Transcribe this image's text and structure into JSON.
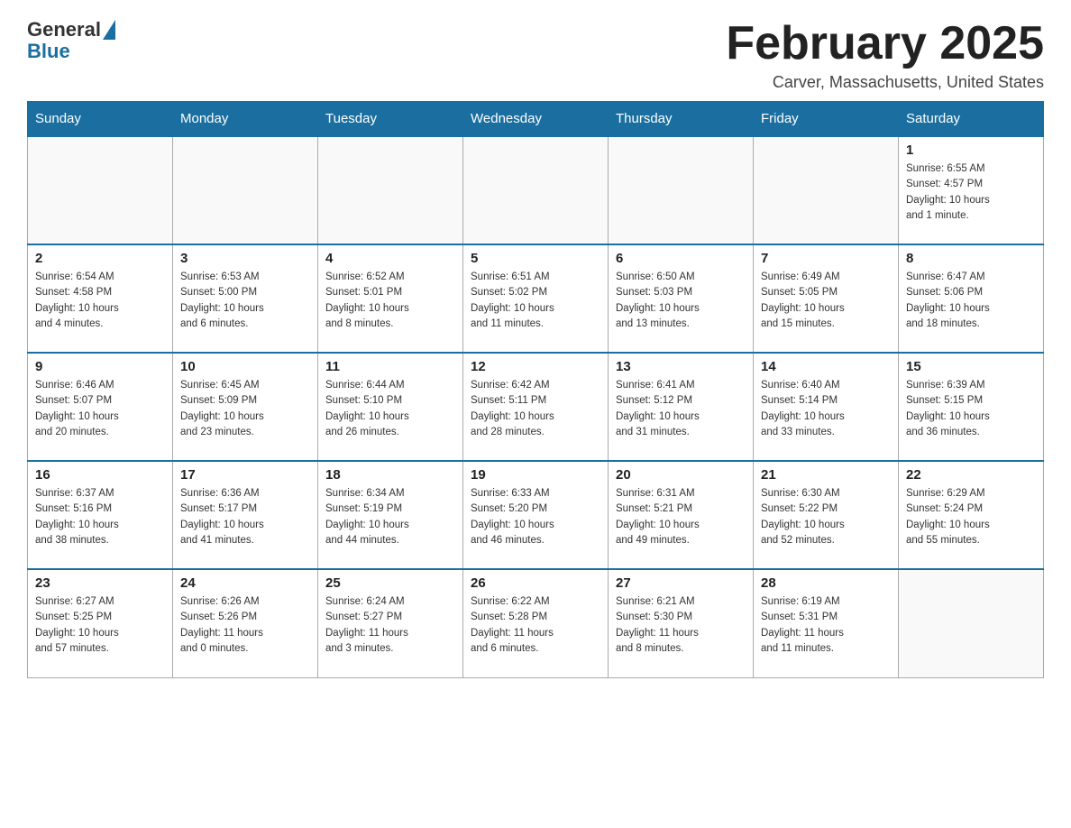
{
  "header": {
    "logo_general": "General",
    "logo_blue": "Blue",
    "month_title": "February 2025",
    "location": "Carver, Massachusetts, United States"
  },
  "days_of_week": [
    "Sunday",
    "Monday",
    "Tuesday",
    "Wednesday",
    "Thursday",
    "Friday",
    "Saturday"
  ],
  "weeks": [
    [
      {
        "day": "",
        "info": ""
      },
      {
        "day": "",
        "info": ""
      },
      {
        "day": "",
        "info": ""
      },
      {
        "day": "",
        "info": ""
      },
      {
        "day": "",
        "info": ""
      },
      {
        "day": "",
        "info": ""
      },
      {
        "day": "1",
        "info": "Sunrise: 6:55 AM\nSunset: 4:57 PM\nDaylight: 10 hours\nand 1 minute."
      }
    ],
    [
      {
        "day": "2",
        "info": "Sunrise: 6:54 AM\nSunset: 4:58 PM\nDaylight: 10 hours\nand 4 minutes."
      },
      {
        "day": "3",
        "info": "Sunrise: 6:53 AM\nSunset: 5:00 PM\nDaylight: 10 hours\nand 6 minutes."
      },
      {
        "day": "4",
        "info": "Sunrise: 6:52 AM\nSunset: 5:01 PM\nDaylight: 10 hours\nand 8 minutes."
      },
      {
        "day": "5",
        "info": "Sunrise: 6:51 AM\nSunset: 5:02 PM\nDaylight: 10 hours\nand 11 minutes."
      },
      {
        "day": "6",
        "info": "Sunrise: 6:50 AM\nSunset: 5:03 PM\nDaylight: 10 hours\nand 13 minutes."
      },
      {
        "day": "7",
        "info": "Sunrise: 6:49 AM\nSunset: 5:05 PM\nDaylight: 10 hours\nand 15 minutes."
      },
      {
        "day": "8",
        "info": "Sunrise: 6:47 AM\nSunset: 5:06 PM\nDaylight: 10 hours\nand 18 minutes."
      }
    ],
    [
      {
        "day": "9",
        "info": "Sunrise: 6:46 AM\nSunset: 5:07 PM\nDaylight: 10 hours\nand 20 minutes."
      },
      {
        "day": "10",
        "info": "Sunrise: 6:45 AM\nSunset: 5:09 PM\nDaylight: 10 hours\nand 23 minutes."
      },
      {
        "day": "11",
        "info": "Sunrise: 6:44 AM\nSunset: 5:10 PM\nDaylight: 10 hours\nand 26 minutes."
      },
      {
        "day": "12",
        "info": "Sunrise: 6:42 AM\nSunset: 5:11 PM\nDaylight: 10 hours\nand 28 minutes."
      },
      {
        "day": "13",
        "info": "Sunrise: 6:41 AM\nSunset: 5:12 PM\nDaylight: 10 hours\nand 31 minutes."
      },
      {
        "day": "14",
        "info": "Sunrise: 6:40 AM\nSunset: 5:14 PM\nDaylight: 10 hours\nand 33 minutes."
      },
      {
        "day": "15",
        "info": "Sunrise: 6:39 AM\nSunset: 5:15 PM\nDaylight: 10 hours\nand 36 minutes."
      }
    ],
    [
      {
        "day": "16",
        "info": "Sunrise: 6:37 AM\nSunset: 5:16 PM\nDaylight: 10 hours\nand 38 minutes."
      },
      {
        "day": "17",
        "info": "Sunrise: 6:36 AM\nSunset: 5:17 PM\nDaylight: 10 hours\nand 41 minutes."
      },
      {
        "day": "18",
        "info": "Sunrise: 6:34 AM\nSunset: 5:19 PM\nDaylight: 10 hours\nand 44 minutes."
      },
      {
        "day": "19",
        "info": "Sunrise: 6:33 AM\nSunset: 5:20 PM\nDaylight: 10 hours\nand 46 minutes."
      },
      {
        "day": "20",
        "info": "Sunrise: 6:31 AM\nSunset: 5:21 PM\nDaylight: 10 hours\nand 49 minutes."
      },
      {
        "day": "21",
        "info": "Sunrise: 6:30 AM\nSunset: 5:22 PM\nDaylight: 10 hours\nand 52 minutes."
      },
      {
        "day": "22",
        "info": "Sunrise: 6:29 AM\nSunset: 5:24 PM\nDaylight: 10 hours\nand 55 minutes."
      }
    ],
    [
      {
        "day": "23",
        "info": "Sunrise: 6:27 AM\nSunset: 5:25 PM\nDaylight: 10 hours\nand 57 minutes."
      },
      {
        "day": "24",
        "info": "Sunrise: 6:26 AM\nSunset: 5:26 PM\nDaylight: 11 hours\nand 0 minutes."
      },
      {
        "day": "25",
        "info": "Sunrise: 6:24 AM\nSunset: 5:27 PM\nDaylight: 11 hours\nand 3 minutes."
      },
      {
        "day": "26",
        "info": "Sunrise: 6:22 AM\nSunset: 5:28 PM\nDaylight: 11 hours\nand 6 minutes."
      },
      {
        "day": "27",
        "info": "Sunrise: 6:21 AM\nSunset: 5:30 PM\nDaylight: 11 hours\nand 8 minutes."
      },
      {
        "day": "28",
        "info": "Sunrise: 6:19 AM\nSunset: 5:31 PM\nDaylight: 11 hours\nand 11 minutes."
      },
      {
        "day": "",
        "info": ""
      }
    ]
  ]
}
